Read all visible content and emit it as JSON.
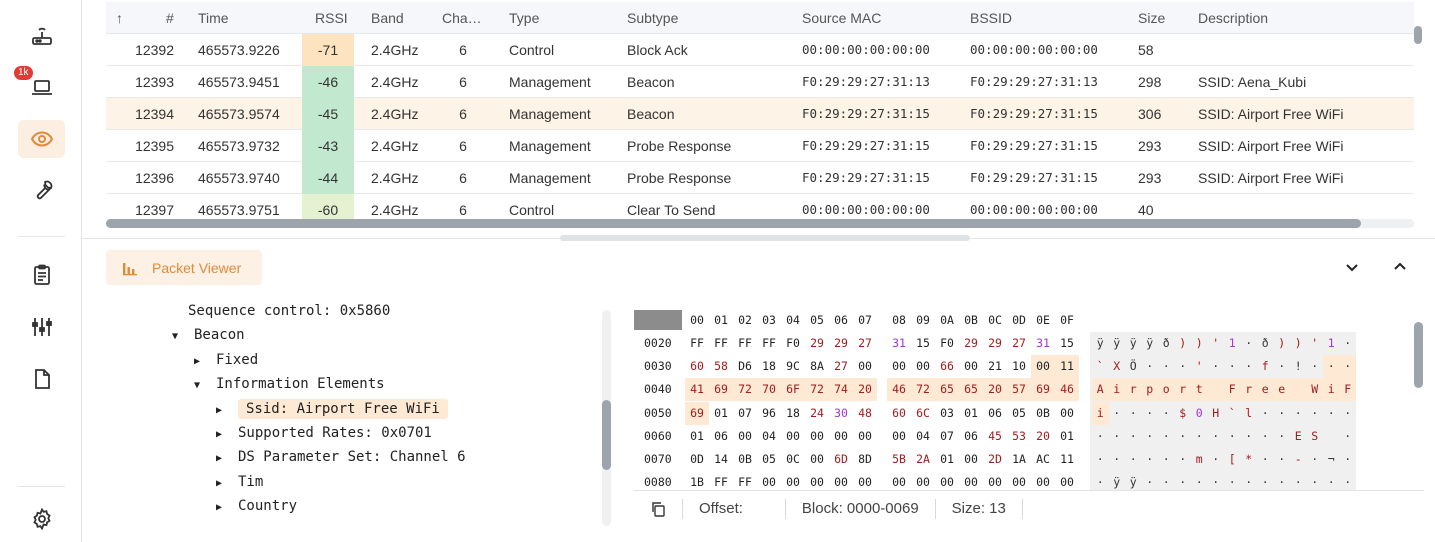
{
  "sidebar": {
    "items": [
      {
        "name": "router-icon",
        "active": false
      },
      {
        "name": "laptop-icon",
        "active": false,
        "badge": "1k"
      },
      {
        "name": "eye-icon",
        "active": true
      },
      {
        "name": "wrench-icon",
        "active": false
      },
      {
        "name": "clipboard-icon",
        "active": false
      },
      {
        "name": "equalizer-icon",
        "active": false
      },
      {
        "name": "document-icon",
        "active": false
      },
      {
        "name": "gear-icon",
        "active": false
      }
    ],
    "accent": "#e08a3c"
  },
  "table": {
    "sort_indicator": "↑",
    "headers": {
      "num": "#",
      "time": "Time",
      "rssi": "RSSI",
      "band": "Band",
      "channel": "Cha…",
      "type": "Type",
      "subtype": "Subtype",
      "source_mac": "Source MAC",
      "bssid": "BSSID",
      "size": "Size",
      "description": "Description"
    },
    "rows": [
      {
        "num": "12392",
        "time": "465573.9226",
        "rssi": "-71",
        "rssi_color": "#fde3bf",
        "band": "2.4GHz",
        "channel": "6",
        "type": "Control",
        "subtype": "Block Ack",
        "source_mac": "00:00:00:00:00:00",
        "bssid": "00:00:00:00:00:00",
        "size": "58",
        "description": ""
      },
      {
        "num": "12393",
        "time": "465573.9451",
        "rssi": "-46",
        "rssi_color": "#c3e8d0",
        "band": "2.4GHz",
        "channel": "6",
        "type": "Management",
        "subtype": "Beacon",
        "source_mac": "F0:29:29:27:31:13",
        "bssid": "F0:29:29:27:31:13",
        "size": "298",
        "description": "SSID: Aena_Kubi"
      },
      {
        "num": "12394",
        "time": "465573.9574",
        "rssi": "-45",
        "rssi_color": "#c3e8d0",
        "band": "2.4GHz",
        "channel": "6",
        "type": "Management",
        "subtype": "Beacon",
        "source_mac": "F0:29:29:27:31:15",
        "bssid": "F0:29:29:27:31:15",
        "size": "306",
        "description": "SSID: Airport Free WiFi",
        "selected": true
      },
      {
        "num": "12395",
        "time": "465573.9732",
        "rssi": "-43",
        "rssi_color": "#c3e8d0",
        "band": "2.4GHz",
        "channel": "6",
        "type": "Management",
        "subtype": "Probe Response",
        "source_mac": "F0:29:29:27:31:15",
        "bssid": "F0:29:29:27:31:15",
        "size": "293",
        "description": "SSID: Airport Free WiFi"
      },
      {
        "num": "12396",
        "time": "465573.9740",
        "rssi": "-44",
        "rssi_color": "#c3e8d0",
        "band": "2.4GHz",
        "channel": "6",
        "type": "Management",
        "subtype": "Probe Response",
        "source_mac": "F0:29:29:27:31:15",
        "bssid": "F0:29:29:27:31:15",
        "size": "293",
        "description": "SSID: Airport Free WiFi"
      },
      {
        "num": "12397",
        "time": "465573.9751",
        "rssi": "-60",
        "rssi_color": "#e4f2d2",
        "band": "2.4GHz",
        "channel": "6",
        "type": "Control",
        "subtype": "Clear To Send",
        "source_mac": "00:00:00:00:00:00",
        "bssid": "00:00:00:00:00:00",
        "size": "40",
        "description": ""
      }
    ]
  },
  "packet_viewer": {
    "tab_label": "Packet Viewer",
    "tree": [
      {
        "label": "Sequence control: 0x5860",
        "depth": 0,
        "arrow": ""
      },
      {
        "label": "Beacon",
        "depth": 1,
        "arrow": "down"
      },
      {
        "label": "Fixed",
        "depth": 2,
        "arrow": "right"
      },
      {
        "label": "Information Elements",
        "depth": 2,
        "arrow": "down"
      },
      {
        "label": "Ssid: Airport Free WiFi",
        "depth": 3,
        "arrow": "right",
        "selected": true
      },
      {
        "label": "Supported Rates: 0x0701",
        "depth": 3,
        "arrow": "right"
      },
      {
        "label": "DS Parameter Set: Channel 6",
        "depth": 3,
        "arrow": "right"
      },
      {
        "label": "Tim",
        "depth": 3,
        "arrow": "right"
      },
      {
        "label": "Country",
        "depth": 3,
        "arrow": "right"
      }
    ],
    "hex": {
      "columns": [
        "00",
        "01",
        "02",
        "03",
        "04",
        "05",
        "06",
        "07",
        "08",
        "09",
        "0A",
        "0B",
        "0C",
        "0D",
        "0E",
        "0F"
      ],
      "rows": [
        {
          "offset": "0020",
          "bytes": [
            "FF",
            "FF",
            "FF",
            "FF",
            "F0",
            "29",
            "29",
            "27",
            "31",
            "15",
            "F0",
            "29",
            "29",
            "27",
            "31",
            "15"
          ],
          "ascii": [
            "ÿ",
            "ÿ",
            "ÿ",
            "ÿ",
            "ð",
            ")",
            ")",
            "'",
            "1",
            "·",
            "ð",
            ")",
            ")",
            "'",
            "1",
            "·"
          ]
        },
        {
          "offset": "0030",
          "bytes": [
            "60",
            "58",
            "D6",
            "18",
            "9C",
            "8A",
            "27",
            "00",
            "00",
            "00",
            "66",
            "00",
            "21",
            "10",
            "00",
            "11"
          ],
          "ascii": [
            "`",
            "X",
            "Ö",
            "·",
            "·",
            "·",
            "'",
            "·",
            "·",
            "·",
            "f",
            "·",
            "!",
            "·",
            "·",
            "·"
          ]
        },
        {
          "offset": "0040",
          "bytes": [
            "41",
            "69",
            "72",
            "70",
            "6F",
            "72",
            "74",
            "20",
            "46",
            "72",
            "65",
            "65",
            "20",
            "57",
            "69",
            "46"
          ],
          "ascii": [
            "A",
            "i",
            "r",
            "p",
            "o",
            "r",
            "t",
            " ",
            "F",
            "r",
            "e",
            "e",
            " ",
            "W",
            "i",
            "F"
          ]
        },
        {
          "offset": "0050",
          "bytes": [
            "69",
            "01",
            "07",
            "96",
            "18",
            "24",
            "30",
            "48",
            "60",
            "6C",
            "03",
            "01",
            "06",
            "05",
            "0B",
            "00"
          ],
          "ascii": [
            "i",
            "·",
            "·",
            "·",
            "·",
            "$",
            "0",
            "H",
            "`",
            "l",
            "·",
            "·",
            "·",
            "·",
            "·",
            "·"
          ]
        },
        {
          "offset": "0060",
          "bytes": [
            "01",
            "06",
            "00",
            "04",
            "00",
            "00",
            "00",
            "00",
            "00",
            "04",
            "07",
            "06",
            "45",
            "53",
            "20",
            "01"
          ],
          "ascii": [
            "·",
            "·",
            "·",
            "·",
            "·",
            "·",
            "·",
            "·",
            "·",
            "·",
            "·",
            "·",
            "E",
            "S",
            " ",
            "·"
          ]
        },
        {
          "offset": "0070",
          "bytes": [
            "0D",
            "14",
            "0B",
            "05",
            "0C",
            "00",
            "6D",
            "8D",
            "5B",
            "2A",
            "01",
            "00",
            "2D",
            "1A",
            "AC",
            "11"
          ],
          "ascii": [
            "·",
            "·",
            "·",
            "·",
            "·",
            "·",
            "m",
            "·",
            "[",
            "*",
            "·",
            "·",
            "-",
            "·",
            "¬",
            "·"
          ]
        },
        {
          "offset": "0080",
          "bytes": [
            "1B",
            "FF",
            "FF",
            "00",
            "00",
            "00",
            "00",
            "00",
            "00",
            "00",
            "00",
            "00",
            "00",
            "00",
            "00",
            "00"
          ],
          "ascii": [
            "·",
            "ÿ",
            "ÿ",
            "·",
            "·",
            "·",
            "·",
            "·",
            "·",
            "·",
            "·",
            "·",
            "·",
            "·",
            "·",
            "·"
          ]
        }
      ]
    },
    "status": {
      "offset_label": "Offset:",
      "offset_value": "",
      "block_label": "Block: 0000-0069",
      "size_label": "Size: 13"
    }
  }
}
